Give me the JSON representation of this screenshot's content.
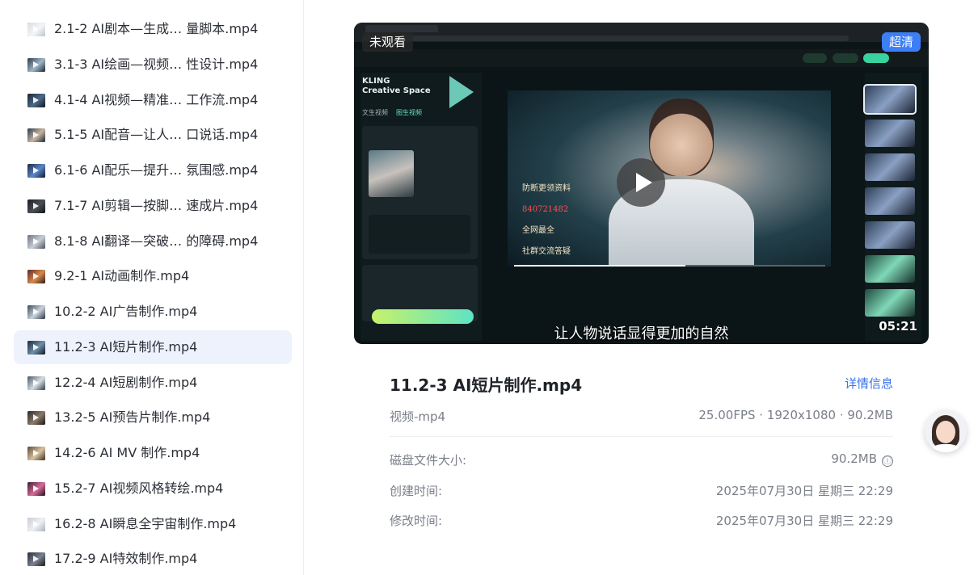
{
  "file_list": [
    {
      "name": "2.1-2 AI剧本—生成… 量脚本.mp4",
      "thumb": [
        "#d9dde3",
        "#f4f5f7",
        "#bfc5ce"
      ]
    },
    {
      "name": "3.1-3 AI绘画—视频… 性设计.mp4",
      "thumb": [
        "#2b3b4d",
        "#9fb6c8",
        "#1a2533"
      ]
    },
    {
      "name": "4.1-4 AI视频—精准… 工作流.mp4",
      "thumb": [
        "#1d2633",
        "#4c6a8a",
        "#0e141c"
      ]
    },
    {
      "name": "5.1-5 AI配音—让人… 口说话.mp4",
      "thumb": [
        "#2a3c4e",
        "#c8b49e",
        "#1c2835"
      ]
    },
    {
      "name": "6.1-6 AI配乐—提升… 氛围感.mp4",
      "thumb": [
        "#1a2a44",
        "#5b86c7",
        "#0f1830"
      ]
    },
    {
      "name": "7.1-7 AI剪辑—按脚… 速成片.mp4",
      "thumb": [
        "#1c1f24",
        "#4a4f57",
        "#111316"
      ]
    },
    {
      "name": "8.1-8 AI翻译—突破… 的障碍.mp4",
      "thumb": [
        "#6d7480",
        "#c9ced6",
        "#4a505a"
      ]
    },
    {
      "name": "9.2-1 AI动画制作.mp4",
      "thumb": [
        "#5a2a2a",
        "#d88a4a",
        "#2a1a1a"
      ]
    },
    {
      "name": "10.2-2 AI广告制作.mp4",
      "thumb": [
        "#3a4a5a",
        "#c9d2dc",
        "#2a3440"
      ]
    },
    {
      "name": "11.2-3 AI短片制作.mp4",
      "thumb": [
        "#1a2a3a",
        "#6f8fa8",
        "#0f1822"
      ]
    },
    {
      "name": "12.2-4 AI短剧制作.mp4",
      "thumb": [
        "#4a5a6a",
        "#d8dde3",
        "#2e3a46"
      ]
    },
    {
      "name": "13.2-5 AI预告片制作.mp4",
      "thumb": [
        "#2e2a26",
        "#8a7a6a",
        "#1a1714"
      ]
    },
    {
      "name": "14.2-6 AI MV 制作.mp4",
      "thumb": [
        "#5a4a3a",
        "#d8c2a0",
        "#3a2e22"
      ]
    },
    {
      "name": "15.2-7 AI视频风格转绘.mp4",
      "thumb": [
        "#3a1e2e",
        "#d86a9a",
        "#20121a"
      ]
    },
    {
      "name": "16.2-8 AI瞬息全宇宙制作.mp4",
      "thumb": [
        "#c9ced6",
        "#eef0f3",
        "#aab1bb"
      ]
    },
    {
      "name": "17.2-9 AI特效制作.mp4",
      "thumb": [
        "#2a2e36",
        "#7a8290",
        "#16191e"
      ]
    }
  ],
  "active_index": 9,
  "player": {
    "badge_unwatched": "未观看",
    "badge_quality": "超清",
    "subtitle": "让人物说话显得更加的自然",
    "duration": "05:21",
    "progress_fraction": 0.55,
    "brand_text": "KLING\nCreative Space",
    "panel_tabs": [
      "文生视频",
      "图生视频"
    ],
    "video_caption_lines": [
      "防断更领资料",
      "840721482",
      "全网最全",
      "社群交流答疑"
    ]
  },
  "video": {
    "title": "11.2-3 AI短片制作.mp4",
    "details_link": "详情信息",
    "type": "视频-mp4",
    "spec": "25.00FPS · 1920x1080 · 90.2MB"
  },
  "info_rows": [
    {
      "label": "磁盘文件大小:",
      "value": "90.2MB",
      "has_icon": true
    },
    {
      "label": "创建时间:",
      "value": "2025年07月30日 星期三 22:29",
      "has_icon": false
    },
    {
      "label": "修改时间:",
      "value": "2025年07月30日 星期三 22:29",
      "has_icon": false
    }
  ],
  "icons": {
    "info": "ⓘ"
  },
  "colors": {
    "accent": "#3a73e8",
    "active_row_bg": "#eef2fd",
    "quality_badge": "#3d7ef6"
  }
}
